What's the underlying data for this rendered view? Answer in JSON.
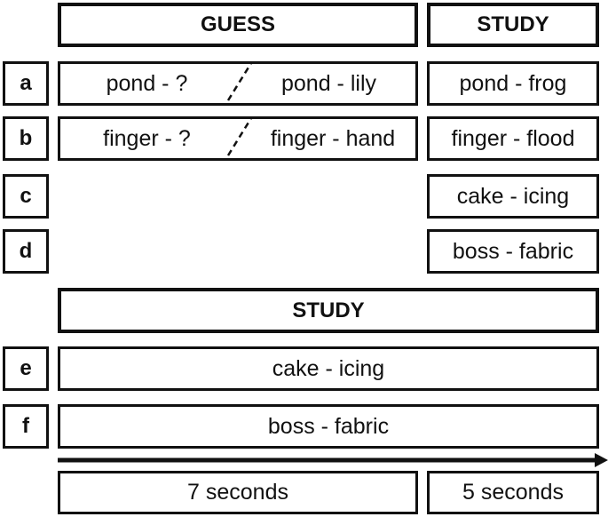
{
  "headers": {
    "guess": "GUESS",
    "study_top": "STUDY",
    "study_bottom": "STUDY"
  },
  "rows": [
    {
      "label": "a",
      "guess_left": "pond - ?",
      "guess_right": "pond - lily",
      "study": "pond - frog"
    },
    {
      "label": "b",
      "guess_left": "finger - ?",
      "guess_right": "finger - hand",
      "study": "finger - flood"
    },
    {
      "label": "c",
      "study": "cake - icing"
    },
    {
      "label": "d",
      "study": "boss - fabric"
    },
    {
      "label": "e",
      "study": "cake - icing"
    },
    {
      "label": "f",
      "study": "boss - fabric"
    }
  ],
  "timeline": {
    "guess_duration": "7 seconds",
    "study_duration": "5 seconds"
  }
}
